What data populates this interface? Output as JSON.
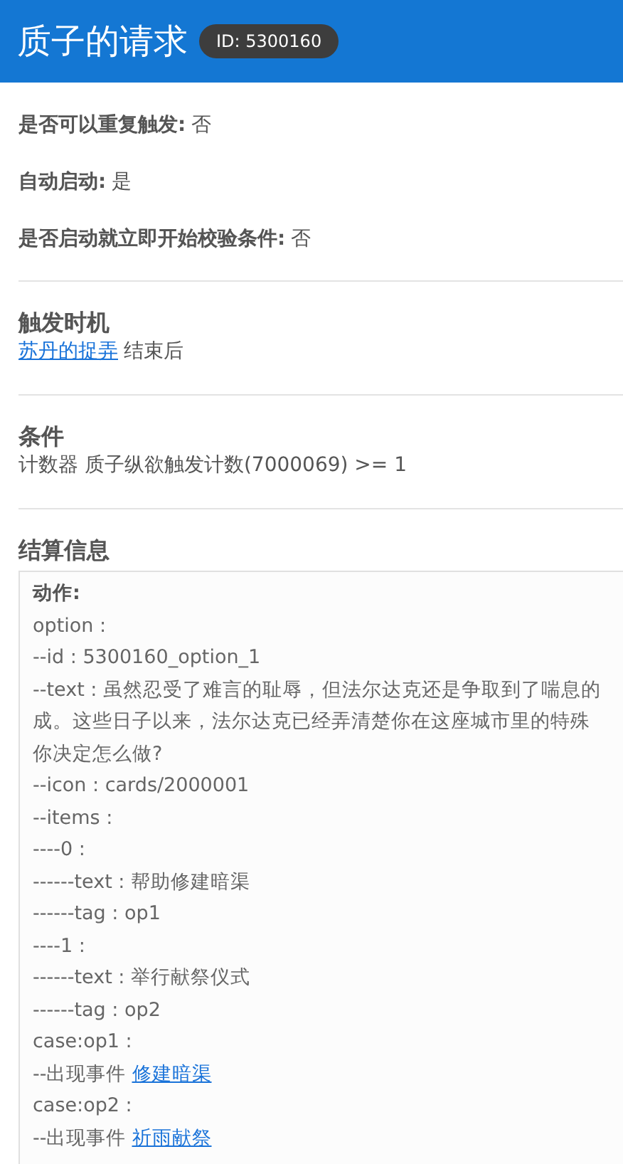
{
  "header": {
    "title": "质子的请求",
    "id_badge": "ID: 5300160"
  },
  "settings": [
    {
      "label": "是否可以重复触发:",
      "value": "否"
    },
    {
      "label": "自动启动:",
      "value": "是"
    },
    {
      "label": "是否启动就立即开始校验条件:",
      "value": "否"
    }
  ],
  "trigger": {
    "heading": "触发时机",
    "link": "苏丹的捉弄",
    "text": "结束后"
  },
  "condition": {
    "heading": "条件",
    "text": "计数器 质子纵欲触发计数(7000069) >= 1"
  },
  "settlement": {
    "heading": "结算信息",
    "action_label": "动作:",
    "lines": [
      {
        "kind": "plain",
        "text": "option :"
      },
      {
        "kind": "plain",
        "text": "--id : 5300160_option_1"
      },
      {
        "kind": "plain",
        "text": "--text : 虽然忍受了难言的耻辱，但法尔达克还是争取到了喘息的"
      },
      {
        "kind": "plain",
        "text": "成。这些日子以来，法尔达克已经弄清楚你在这座城市里的特殊"
      },
      {
        "kind": "plain",
        "text": "你决定怎么做?"
      },
      {
        "kind": "plain",
        "text": "--icon : cards/2000001"
      },
      {
        "kind": "plain",
        "text": "--items :"
      },
      {
        "kind": "plain",
        "text": "----0 :"
      },
      {
        "kind": "plain",
        "text": "------text : 帮助修建暗渠"
      },
      {
        "kind": "plain",
        "text": "------tag : op1"
      },
      {
        "kind": "plain",
        "text": "----1 :"
      },
      {
        "kind": "plain",
        "text": "------text : 举行献祭仪式"
      },
      {
        "kind": "plain",
        "text": "------tag : op2"
      },
      {
        "kind": "plain",
        "text": "case:op1 :"
      },
      {
        "kind": "event",
        "text": "--出现事件",
        "link": "修建暗渠"
      },
      {
        "kind": "plain",
        "text": "case:op2 :"
      },
      {
        "kind": "event",
        "text": "--出现事件",
        "link": "祈雨献祭"
      }
    ]
  }
}
